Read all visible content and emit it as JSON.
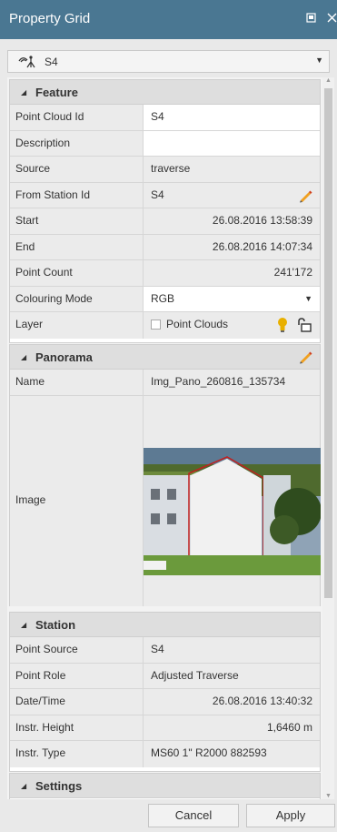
{
  "window": {
    "title": "Property Grid"
  },
  "selector": {
    "value": "S4"
  },
  "feature": {
    "header": "Feature",
    "rows": [
      {
        "name": "Point Cloud Id",
        "value": "S4"
      },
      {
        "name": "Description",
        "value": ""
      },
      {
        "name": "Source",
        "value": "traverse"
      },
      {
        "name": "From Station Id",
        "value": "S4"
      },
      {
        "name": "Start",
        "value": "26.08.2016 13:58:39"
      },
      {
        "name": "End",
        "value": "26.08.2016 14:07:34"
      },
      {
        "name": "Point Count",
        "value": "241'172"
      },
      {
        "name": "Colouring Mode",
        "value": "RGB"
      },
      {
        "name": "Layer",
        "value": "Point Clouds"
      }
    ]
  },
  "panorama": {
    "header": "Panorama",
    "rows": [
      {
        "name": "Name",
        "value": "Img_Pano_260816_135734"
      },
      {
        "name": "Image",
        "value": ""
      }
    ]
  },
  "station": {
    "header": "Station",
    "rows": [
      {
        "name": "Point Source",
        "value": "S4"
      },
      {
        "name": "Point Role",
        "value": "Adjusted Traverse"
      },
      {
        "name": "Date/Time",
        "value": "26.08.2016 13:40:32"
      },
      {
        "name": "Instr. Height",
        "value": "1,6460  m"
      },
      {
        "name": "Instr. Type",
        "value": "MS60 1\" R2000 882593"
      }
    ]
  },
  "settings": {
    "header": "Settings"
  },
  "buttons": {
    "cancel": "Cancel",
    "apply": "Apply"
  },
  "colors": {
    "titlebar": "#4a7792",
    "pencil": "#f0a020",
    "bulb": "#e8b000"
  }
}
